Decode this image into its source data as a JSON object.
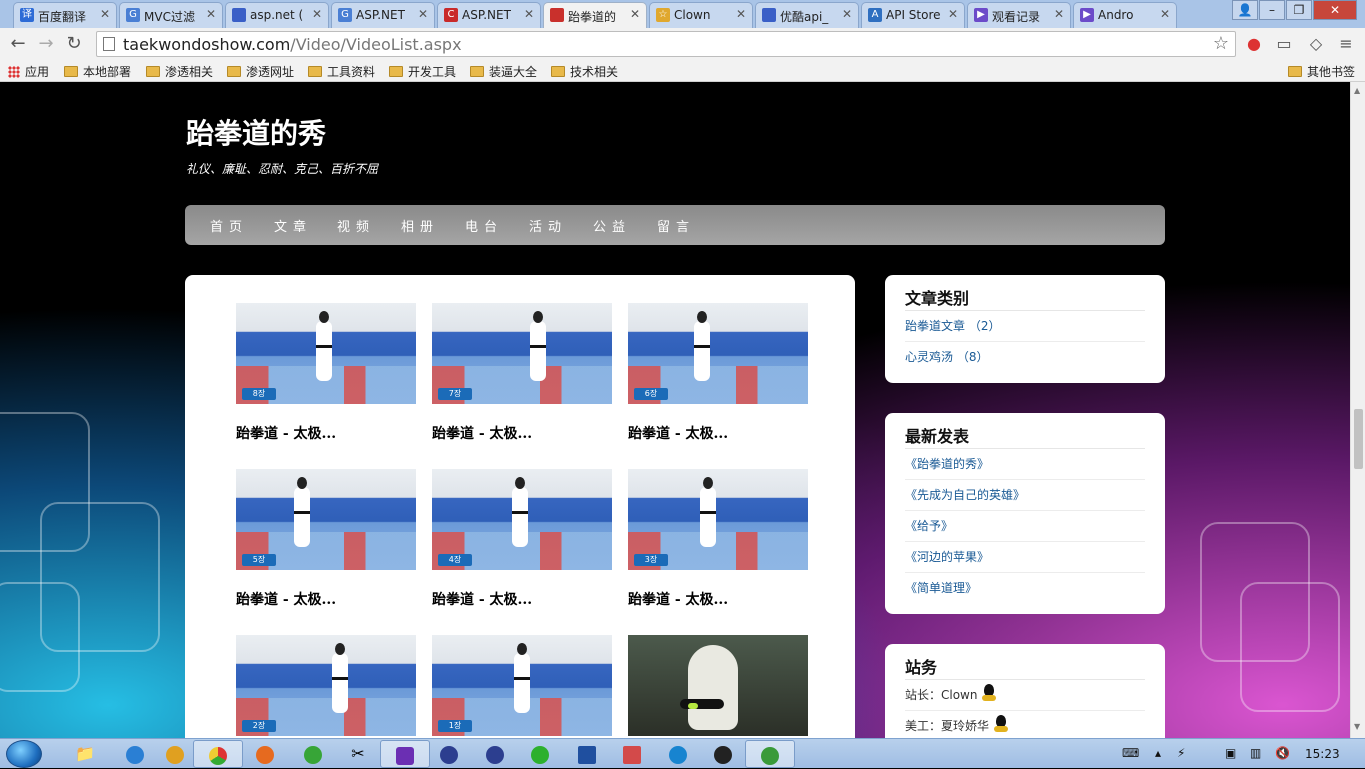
{
  "browser": {
    "tabs": [
      {
        "title": "百度翻译",
        "fav": "译",
        "color": "#2d6bd6"
      },
      {
        "title": "MVC过滤",
        "fav": "G",
        "color": "#4a7fd4"
      },
      {
        "title": "asp.net (",
        "fav": "",
        "color": "#3a5fc7"
      },
      {
        "title": "ASP.NET",
        "fav": "G",
        "color": "#4a7fd4"
      },
      {
        "title": "ASP.NET",
        "fav": "C",
        "color": "#c92a2a"
      },
      {
        "title": "跆拳道的",
        "fav": "",
        "color": "#c9302c"
      },
      {
        "title": "Clown",
        "fav": "☆",
        "color": "#e0a82e"
      },
      {
        "title": "优酷api_",
        "fav": "",
        "color": "#3a5fc7"
      },
      {
        "title": "API Store",
        "fav": "A",
        "color": "#2f6fc0"
      },
      {
        "title": "观看记录",
        "fav": "▶",
        "color": "#6c4bc9"
      },
      {
        "title": "Andro",
        "fav": "▶",
        "color": "#6c4bc9"
      }
    ],
    "url_host": "taekwondoshow.com",
    "url_path": "/Video/VideoList.aspx"
  },
  "bookmarks": [
    "应用",
    "本地部署",
    "渗透相关",
    "渗透网址",
    "工具资料",
    "开发工具",
    "装逼大全",
    "技术相关",
    "其他书签"
  ],
  "site": {
    "title": "跆拳道的秀",
    "subtitle": "礼仪、廉耻、忍耐、克己、百折不屈",
    "nav": [
      "首页",
      "文章",
      "视频",
      "相册",
      "电台",
      "活动",
      "公益",
      "留言"
    ]
  },
  "videos": [
    {
      "title": "跆拳道 - 太极...",
      "badge": "8장"
    },
    {
      "title": "跆拳道 - 太极...",
      "badge": "7장"
    },
    {
      "title": "跆拳道 - 太极...",
      "badge": "6장"
    },
    {
      "title": "跆拳道 - 太极...",
      "badge": "5장"
    },
    {
      "title": "跆拳道 - 太极...",
      "badge": "4장"
    },
    {
      "title": "跆拳道 - 太极...",
      "badge": "3장"
    },
    {
      "title": "",
      "badge": "2장"
    },
    {
      "title": "",
      "badge": "1장"
    },
    {
      "title": "",
      "badge": ""
    }
  ],
  "sidebar": {
    "categories": {
      "title": "文章类别",
      "items": [
        "跆拳道文章 （2）",
        "心灵鸡汤 （8）"
      ]
    },
    "latest": {
      "title": "最新发表",
      "items": [
        "《跆拳道的秀》",
        "《先成为自己的英雄》",
        "《给予》",
        "《河边的苹果》",
        "《简单道理》"
      ]
    },
    "station": {
      "title": "站务",
      "items": [
        "站长：Clown",
        "美工：夏玲娇华"
      ]
    }
  },
  "taskbar": {
    "clock": "15:23"
  }
}
